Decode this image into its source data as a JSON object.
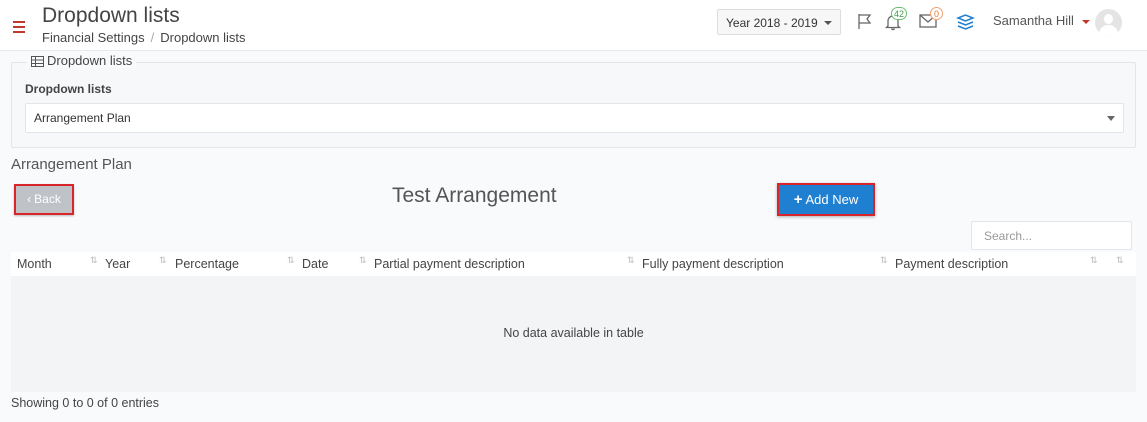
{
  "header": {
    "page_title": "Dropdown lists",
    "breadcrumb": [
      "Financial Settings",
      "Dropdown lists"
    ],
    "year_selected": "Year 2018 - 2019",
    "notifications_count": "42",
    "messages_count": "0",
    "user_name": "Samantha Hill",
    "icons": [
      "hamburger-icon",
      "flag-icon",
      "bell-icon",
      "envelope-icon",
      "layers-icon",
      "chevron-down-icon",
      "user-avatar"
    ]
  },
  "panel": {
    "legend": "Dropdown lists",
    "field_label": "Dropdown lists",
    "selected_value": "Arrangement Plan"
  },
  "section": {
    "title": "Arrangement Plan",
    "back_label": "Back",
    "block_title": "Test Arrangement",
    "add_label": "Add New"
  },
  "table": {
    "search_placeholder": "Search...",
    "columns": [
      "Month",
      "Year",
      "Percentage",
      "Date",
      "Partial payment description",
      "Fully payment description",
      "Payment description"
    ],
    "empty_text": "No data available in table",
    "info": "Showing 0 to 0 of 0 entries"
  },
  "colors": {
    "accent_red": "#c0392b",
    "primary_blue": "#1f7fd1",
    "highlight_border": "#d9252a",
    "badge_green": "#3c9d40",
    "badge_orange": "#e07b39"
  }
}
